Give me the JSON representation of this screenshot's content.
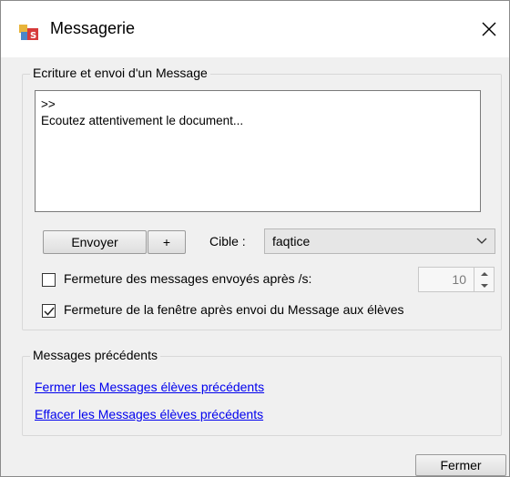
{
  "window": {
    "title": "Messagerie",
    "close_label": "×"
  },
  "compose": {
    "group_label": "Ecriture et envoi d'un Message",
    "message_lines": [
      ">>",
      "",
      "Ecoutez attentivement le document..."
    ],
    "send_label": "Envoyer",
    "plus_label": "+",
    "target_label": "Cible :",
    "target_value": "faqtice",
    "close_after_label": "Fermeture des messages envoyés après /s:",
    "close_after_checked": false,
    "close_after_seconds": "10",
    "close_window_label": "Fermeture de la fenêtre après envoi du Message aux élèves",
    "close_window_checked": true
  },
  "previous": {
    "group_label": "Messages précédents",
    "link_close": "Fermer les Messages élèves précédents",
    "link_erase": "Effacer les Messages élèves précédents"
  },
  "footer": {
    "close_button": "Fermer"
  },
  "colors": {
    "link": "#0000ee",
    "window_bg": "#f0f0f0",
    "titlebar_bg": "#ffffff"
  }
}
